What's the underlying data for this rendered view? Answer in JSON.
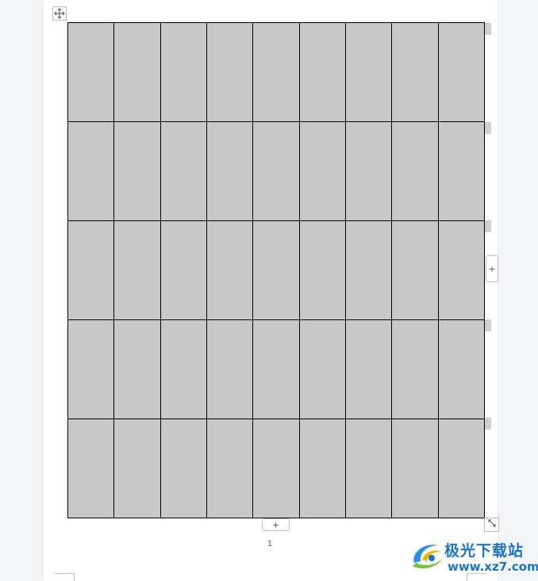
{
  "document": {
    "table": {
      "rows": 5,
      "columns": 9,
      "cell_fill": "#c8c8c8",
      "border_color": "#000000",
      "cells": [
        [
          "",
          "",
          "",
          "",
          "",
          "",
          "",
          "",
          ""
        ],
        [
          "",
          "",
          "",
          "",
          "",
          "",
          "",
          "",
          ""
        ],
        [
          "",
          "",
          "",
          "",
          "",
          "",
          "",
          "",
          ""
        ],
        [
          "",
          "",
          "",
          "",
          "",
          "",
          "",
          "",
          ""
        ],
        [
          "",
          "",
          "",
          "",
          "",
          "",
          "",
          "",
          ""
        ]
      ]
    },
    "controls": {
      "move_handle_icon": "move-icon",
      "add_column_label": "+",
      "add_row_label": "+",
      "resize_handle_icon": "resize-icon"
    },
    "page_number": "1"
  },
  "watermark": {
    "title": "极光下载站",
    "url": "www.xz7.com",
    "color": "#1b73c9"
  }
}
